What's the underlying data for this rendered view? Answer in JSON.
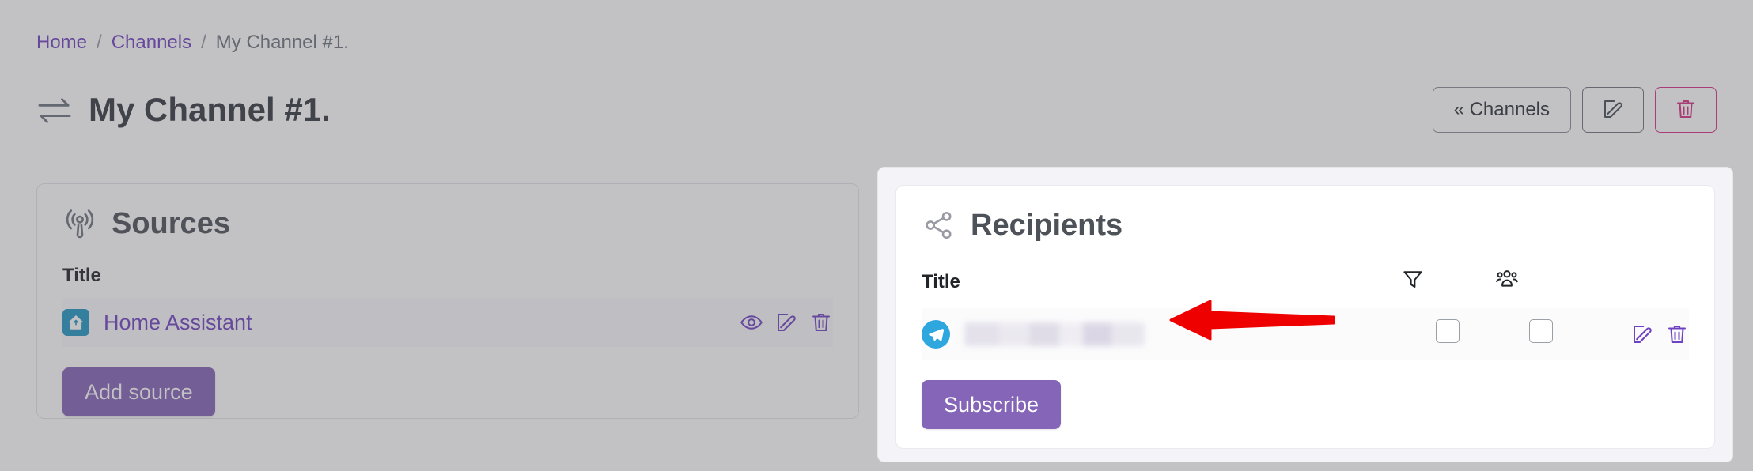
{
  "breadcrumb": {
    "items": [
      {
        "label": "Home",
        "type": "link"
      },
      {
        "label": "Channels",
        "type": "link"
      },
      {
        "label": "My Channel #1.",
        "type": "current"
      }
    ],
    "separator": "/"
  },
  "header": {
    "title": "My Channel #1.",
    "title_icon": "exchange-arrows-icon",
    "actions": {
      "back_label": "« Channels",
      "edit_icon": "pencil-square-icon",
      "delete_icon": "trash-icon",
      "delete_color": "#d63384"
    }
  },
  "sources": {
    "title": "Sources",
    "icon": "broadcast-icon",
    "columns": [
      "Title"
    ],
    "rows": [
      {
        "icon": "home-assistant-icon",
        "title": "Home Assistant",
        "actions": [
          "eye-icon",
          "pencil-square-icon",
          "trash-icon"
        ]
      }
    ],
    "add_button": "Add source"
  },
  "recipients": {
    "title": "Recipients",
    "icon": "share-nodes-icon",
    "columns": [
      {
        "label": "Title",
        "type": "text"
      },
      {
        "label": "",
        "type": "icon",
        "icon": "filter-funnel-icon"
      },
      {
        "label": "",
        "type": "icon",
        "icon": "people-group-icon"
      }
    ],
    "rows": [
      {
        "icon": "telegram-icon",
        "title": "",
        "title_redacted": true,
        "filter_checked": false,
        "group_checked": false,
        "actions": [
          "pencil-square-icon",
          "trash-icon"
        ]
      }
    ],
    "subscribe_button": "Subscribe"
  },
  "annotation": {
    "arrow": "red-left-arrow",
    "color": "#ee0000",
    "points_at": "recipient-row-title"
  },
  "colors": {
    "link": "#6f42c1",
    "primary_button": "#8465b8",
    "danger": "#d63384",
    "telegram": "#2ea6de",
    "home_assistant": "#2196c4",
    "spotlight_bg": "#f4f3f7"
  }
}
